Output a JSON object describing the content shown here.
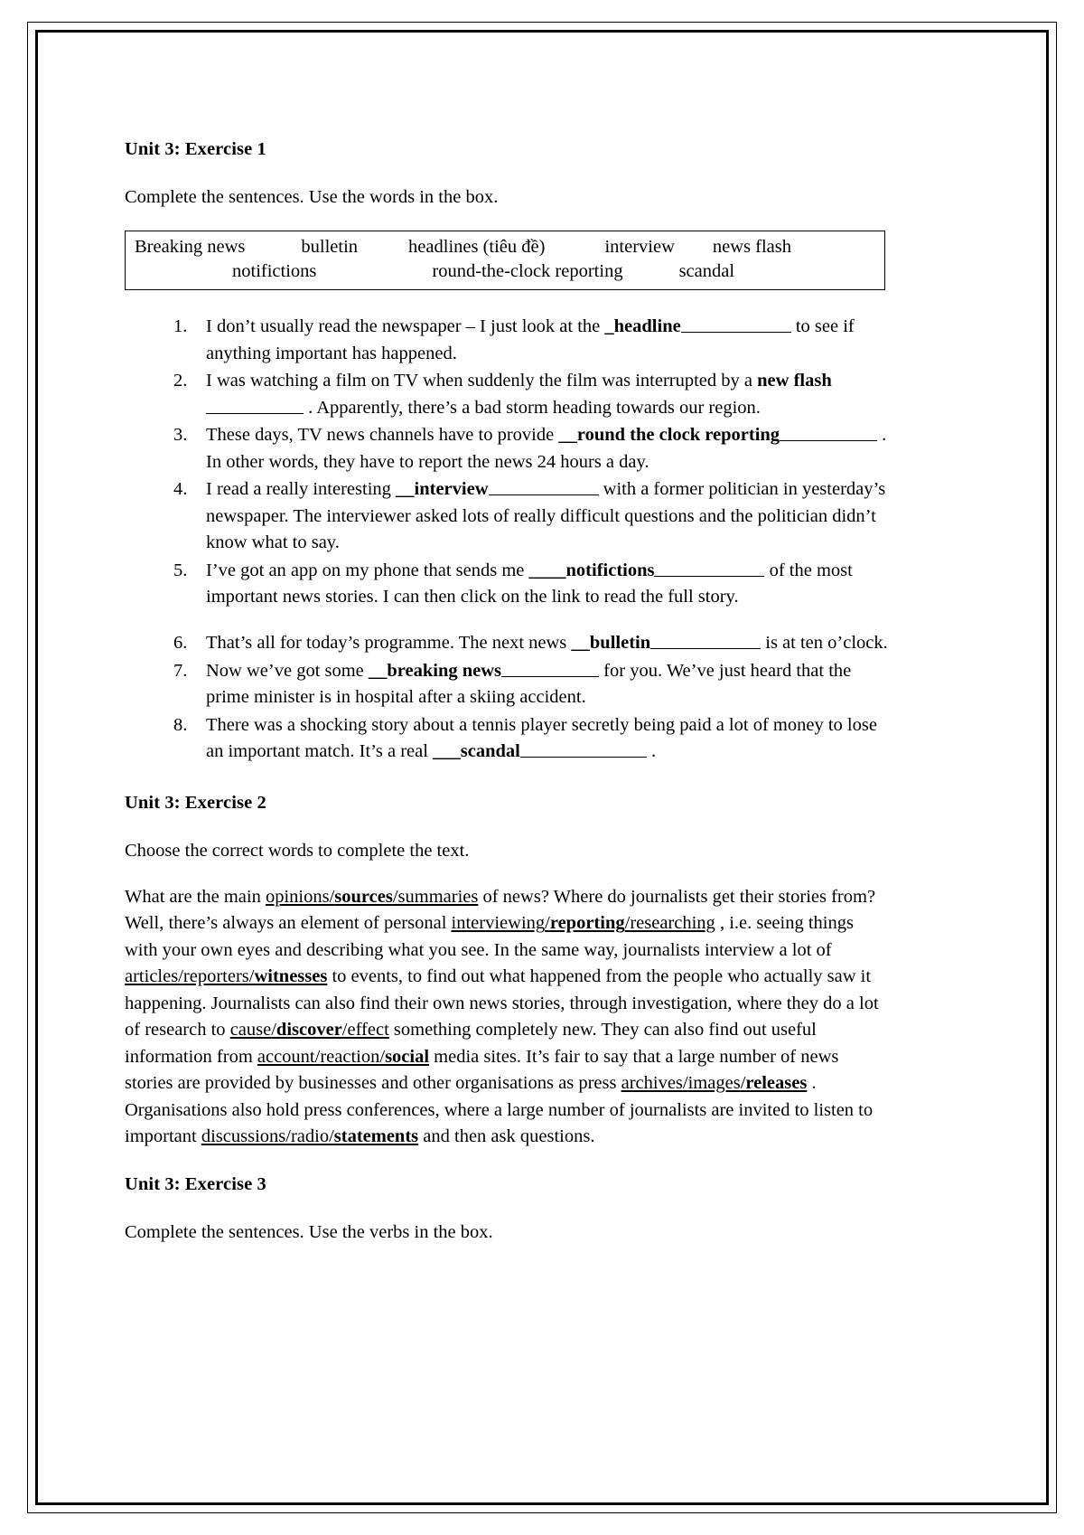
{
  "document": {
    "exercise1": {
      "title": "Unit 3: Exercise 1",
      "instruction": "Complete the sentences. Use the words in the box.",
      "wordbank": {
        "row1": [
          "Breaking news",
          "bulletin",
          "headlines (tiêu đề)",
          "interview",
          "news flash"
        ],
        "row2": [
          "notifictions",
          "round-the-clock reporting",
          "scandal"
        ]
      },
      "items": [
        {
          "number": "1.",
          "pre": "I don’t usually read the newspaper – I just look at the ",
          "lead": "_",
          "answer": "headline",
          "post": " to see if anything important has happened."
        },
        {
          "number": "2.",
          "pre": "I was watching a film on TV when suddenly the film was interrupted by a ",
          "lead": "",
          "answer": "new flash",
          "post": " . Apparently, there’s a bad storm heading towards our region."
        },
        {
          "number": "3.",
          "pre": "These days, TV news channels have to provide ",
          "lead": "__",
          "answer": "round the clock reporting",
          "post": " . In other words, they have to report the news 24 hours a day."
        },
        {
          "number": "4.",
          "pre": "I read a really interesting ",
          "lead": "__",
          "answer": "interview",
          "post": " with a former politician in yesterday’s newspaper. The interviewer asked lots of really difficult questions and the politician didn’t know what to say."
        },
        {
          "number": "5.",
          "pre": "I’ve got an app on my phone that sends me ",
          "lead": "____",
          "answer": "notifictions",
          "post": " of the most important news stories. I can then click on the link to read the full story."
        },
        {
          "number": "6.",
          "pre": "That’s all for today’s programme. The next news ",
          "lead": "__",
          "answer": "bulletin",
          "post": " is at ten o’clock."
        },
        {
          "number": "7.",
          "pre": "Now we’ve got some ",
          "lead": "__",
          "answer": "breaking news",
          "post": " for you. We’ve just heard that the prime minister is in hospital after a skiing accident."
        },
        {
          "number": "8.",
          "pre": "There was a shocking story about a tennis player secretly being paid a lot of money to lose an important match. It’s a real ",
          "lead": "___",
          "answer": "scandal",
          "post": " ."
        }
      ]
    },
    "exercise2": {
      "title": "Unit 3: Exercise 2",
      "instruction": "Choose the correct words to complete the text.",
      "text_runs": [
        {
          "type": "plain",
          "text": "What are the main "
        },
        {
          "type": "choice",
          "options": [
            "opinions",
            "sources",
            "summaries"
          ],
          "correct": "sources"
        },
        {
          "type": "plain",
          "text": " of news? Where do journalists get their stories from? Well, there’s always an element of personal "
        },
        {
          "type": "choice",
          "options": [
            "interviewing",
            "reporting",
            "researching"
          ],
          "correct": "reporting"
        },
        {
          "type": "plain",
          "text": " , i.e. seeing things with your own eyes and describing what you see. In the same way, journalists interview a lot of "
        },
        {
          "type": "choice",
          "options": [
            "articles",
            "reporters",
            "witnesses"
          ],
          "correct": "witnesses"
        },
        {
          "type": "plain",
          "text": " to events, to find out what happened from the people who actually saw it happening. Journalists can also find their own news stories, through investigation, where they do a lot of research to "
        },
        {
          "type": "choice",
          "options": [
            "cause",
            "discover",
            "effect"
          ],
          "correct": "discover"
        },
        {
          "type": "plain",
          "text": " something completely new. They can also find out useful information from "
        },
        {
          "type": "choice",
          "options": [
            "account",
            "reaction",
            "social"
          ],
          "correct": "social"
        },
        {
          "type": "plain",
          "text": " media sites. It’s fair to say that a large number of news stories are provided by businesses and other organisations as press "
        },
        {
          "type": "choice",
          "options": [
            "archives",
            "images",
            "releases"
          ],
          "correct": "releases"
        },
        {
          "type": "plain",
          "text": " . Organisations also hold press conferences, where a large number of journalists are invited to listen to important "
        },
        {
          "type": "choice",
          "options": [
            "discussions",
            "radio",
            "statements"
          ],
          "correct": "statements"
        },
        {
          "type": "plain",
          "text": " and then ask questions."
        }
      ]
    },
    "exercise3": {
      "title": "Unit 3: Exercise 3",
      "instruction": "Complete the sentences. Use the verbs in the box."
    }
  }
}
